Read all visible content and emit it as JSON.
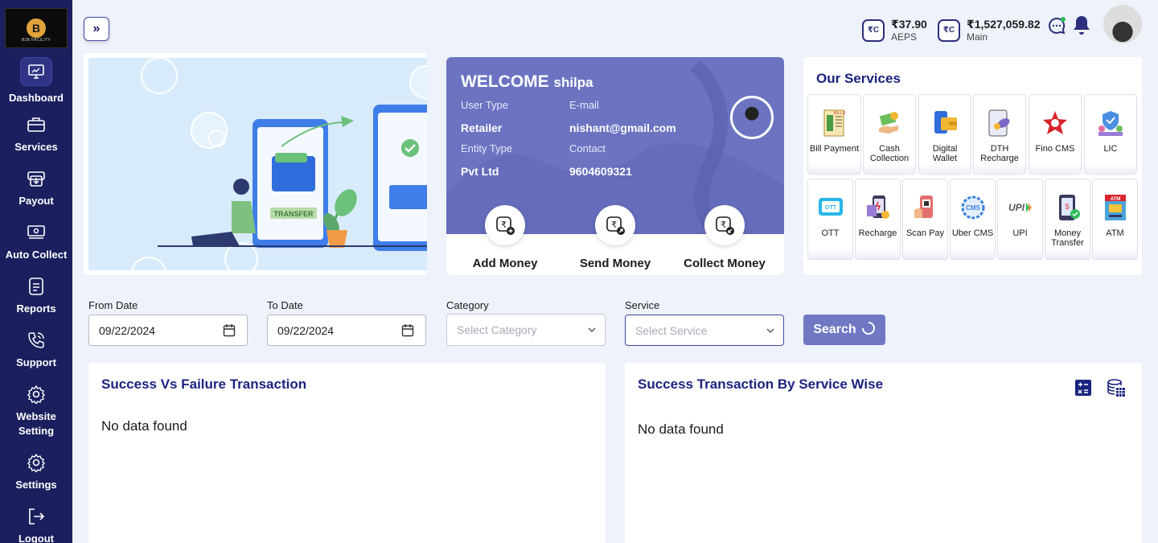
{
  "sidebar": {
    "logo_text": "B2B FACILITY",
    "logo_letter": "B",
    "items": [
      {
        "label": "Dashboard"
      },
      {
        "label": "Services"
      },
      {
        "label": "Payout"
      },
      {
        "label": "Auto Collect"
      },
      {
        "label": "Reports"
      },
      {
        "label": "Support"
      },
      {
        "label": "Website Setting"
      },
      {
        "label": "Settings"
      },
      {
        "label": "Logout"
      }
    ]
  },
  "topbar": {
    "expand_icon": "»",
    "wallets": [
      {
        "amount": "₹37.90",
        "label": "AEPS",
        "icon": "₹C"
      },
      {
        "amount": "₹1,527,059.82",
        "label": "Main",
        "icon": "₹C"
      }
    ]
  },
  "hero": {
    "transfer_text": "TRANSFER"
  },
  "welcome": {
    "title": "WELCOME",
    "name": "shilpa",
    "user_type_label": "User Type",
    "user_type": "Retailer",
    "email_label": "E-mail",
    "email": "nishant@gmail.com",
    "entity_type_label": "Entity Type",
    "entity_type": "Pvt Ltd",
    "contact_label": "Contact",
    "contact": "9604609321",
    "actions": [
      {
        "label": "Add Money"
      },
      {
        "label": "Send Money"
      },
      {
        "label": "Collect Money"
      }
    ]
  },
  "services": {
    "title": "Our Services",
    "row1": [
      {
        "label": "Bill Payment",
        "icon": "bill-icon"
      },
      {
        "label": "Cash Collection",
        "icon": "cash-icon"
      },
      {
        "label": "Digital Wallet",
        "icon": "wallet-icon"
      },
      {
        "label": "DTH Recharge",
        "icon": "dth-icon"
      },
      {
        "label": "Fino CMS",
        "icon": "fino-icon"
      },
      {
        "label": "LIC",
        "icon": "lic-icon"
      }
    ],
    "row2": [
      {
        "label": "OTT",
        "icon": "ott-icon"
      },
      {
        "label": "Recharge",
        "icon": "recharge-icon"
      },
      {
        "label": "Scan Pay",
        "icon": "scan-icon"
      },
      {
        "label": "Uber CMS",
        "icon": "cms-icon"
      },
      {
        "label": "UPI",
        "icon": "upi-icon"
      },
      {
        "label": "Money Transfer",
        "icon": "money-transfer-icon"
      },
      {
        "label": "ATM",
        "icon": "atm-icon"
      }
    ]
  },
  "filters": {
    "from_label": "From Date",
    "from_value": "09/22/2024",
    "to_label": "To Date",
    "to_value": "09/22/2024",
    "category_label": "Category",
    "category_placeholder": "Select Category",
    "service_label": "Service",
    "service_placeholder": "Select Service",
    "search_label": "Search"
  },
  "panels": {
    "left_title": "Success Vs Failure Transaction",
    "left_empty": "No data found",
    "right_title": "Success Transaction By Service Wise",
    "right_empty": "No data found"
  },
  "colors": {
    "sidebar": "#1b1f5e",
    "accent": "#6c74c2",
    "heading": "#1b2380"
  }
}
